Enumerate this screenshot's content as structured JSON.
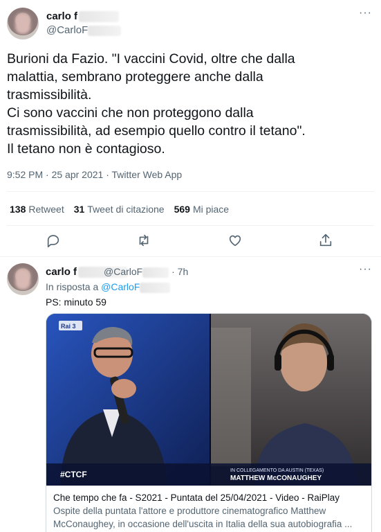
{
  "main_tweet": {
    "name": "carlo f",
    "handle": "@CarloF",
    "body": "Burioni da Fazio. \"I vaccini Covid, oltre che dalla\nmalattia, sembrano proteggere anche dalla\ntrasmissibilità.\nCi sono vaccini che non proteggono dalla\ntrasmissibilità, ad esempio quello contro il tetano\".\nIl tetano non è contagioso.",
    "meta": "9:52 PM · 25 apr 2021 · Twitter Web App",
    "stats": {
      "retweets_count": "138",
      "retweets_label": "Retweet",
      "quotes_count": "31",
      "quotes_label": "Tweet di citazione",
      "likes_count": "569",
      "likes_label": "Mi piace"
    },
    "more_label": "···"
  },
  "reply_tweet": {
    "name": "carlo f",
    "handle": "@CarloF",
    "time": "· 7h",
    "in_reply_label": "In risposta a",
    "in_reply_handle": "@CarloF",
    "text": "PS: minuto 59",
    "more_label": "···",
    "card": {
      "caption_small": "IN COLLEGAMENTO DA AUSTIN (TEXAS)",
      "caption_name": "MATTHEW McCONAUGHEY",
      "logo": "Rai 3",
      "show_tag": "#CTCF",
      "title": "Che tempo che fa - S2021 - Puntata del 25/04/2021 - Video - RaiPlay",
      "description": "Ospite della puntata l'attore e produttore cinematografico Matthew McConaughey, in occasione dell'uscita in Italia della sua autobiografia ..."
    }
  },
  "icons": [
    "reply-icon",
    "retweet-icon",
    "like-icon",
    "share-icon",
    "more-icon"
  ]
}
